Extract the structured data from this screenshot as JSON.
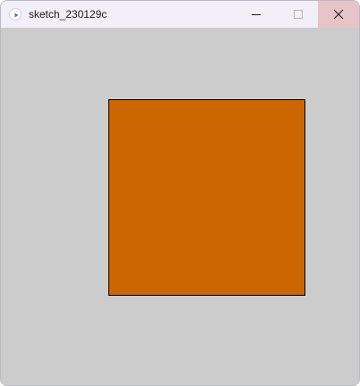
{
  "window": {
    "title": "sketch_230129c",
    "icon": "processing-play-icon",
    "controls": {
      "minimize_icon": "minimize-icon",
      "maximize_icon": "maximize-icon",
      "close_icon": "close-icon"
    }
  },
  "canvas": {
    "background_color": "#cccccc",
    "shape": {
      "type": "square",
      "fill_color": "#cc6600",
      "stroke_color": "#000000"
    }
  }
}
